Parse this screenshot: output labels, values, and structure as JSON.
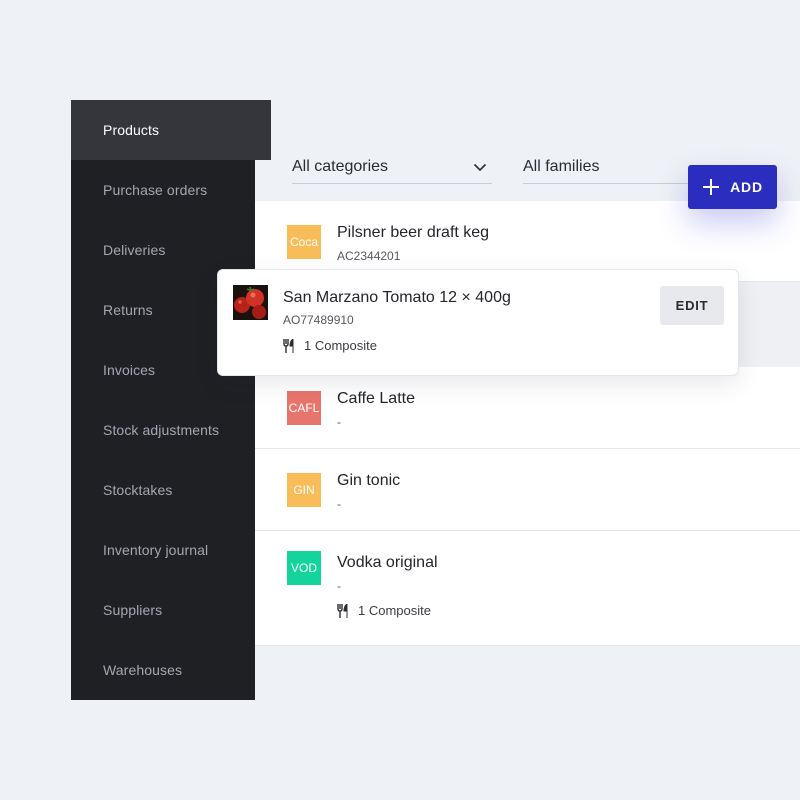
{
  "sidebar": {
    "items": [
      {
        "label": "Products",
        "active": true
      },
      {
        "label": "Purchase orders"
      },
      {
        "label": "Deliveries"
      },
      {
        "label": "Returns"
      },
      {
        "label": "Invoices"
      },
      {
        "label": "Stock adjustments"
      },
      {
        "label": "Stocktakes"
      },
      {
        "label": "Inventory journal"
      },
      {
        "label": "Suppliers"
      },
      {
        "label": "Warehouses"
      }
    ]
  },
  "filters": {
    "category": "All categories",
    "family": "All families"
  },
  "toolbar": {
    "add_label": "ADD",
    "edit_label": "EDIT"
  },
  "products": [
    {
      "badge": "Coca",
      "badge_color": "#f8bd58",
      "name": "Pilsner beer draft keg",
      "code": "AC2344201"
    },
    {
      "badge": "CAFL",
      "badge_color": "#e8756c",
      "name": "Caffe Latte",
      "code": "-"
    },
    {
      "badge": "GIN",
      "badge_color": "#f8bd58",
      "name": "Gin tonic",
      "code": "-"
    },
    {
      "badge": "VOD",
      "badge_color": "#12d49c",
      "name": "Vodka original",
      "code": "-",
      "composite": "1 Composite"
    }
  ],
  "selected_product": {
    "name": "San Marzano Tomato 12 × 400g",
    "code": "AO77489910",
    "composite": "1 Composite"
  },
  "colors": {
    "accent": "#2a2dbd",
    "sidebar_bg": "#1f2024",
    "sidebar_active": "#34363c"
  }
}
